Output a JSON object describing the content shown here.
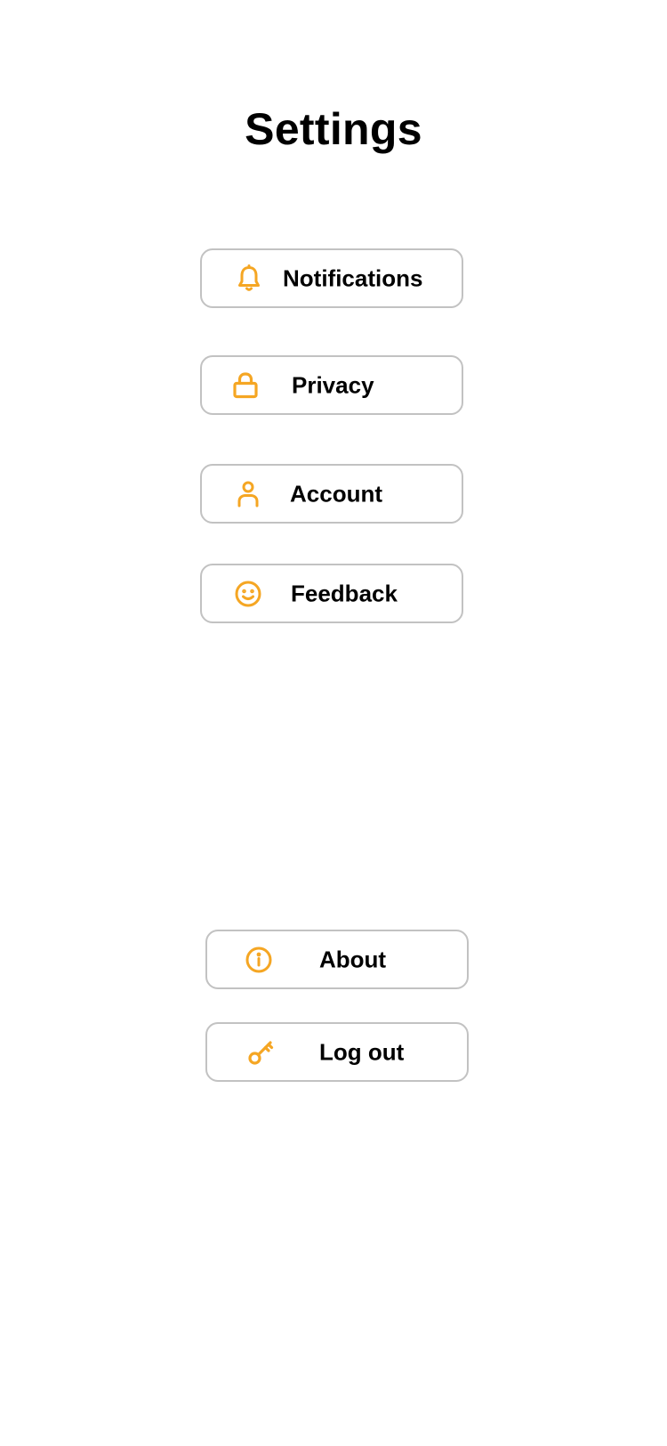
{
  "page": {
    "title": "Settings"
  },
  "theme": {
    "accent_color": "#F5A623",
    "border_color": "#C2C2C2",
    "text_color": "#000000",
    "background_color": "#FFFFFF"
  },
  "menu": {
    "items": [
      {
        "label": "Notifications",
        "icon": "bell-icon"
      },
      {
        "label": "Privacy",
        "icon": "lock-icon"
      },
      {
        "label": "Account",
        "icon": "user-icon"
      },
      {
        "label": "Feedback",
        "icon": "smiley-icon"
      }
    ]
  },
  "footer_menu": {
    "items": [
      {
        "label": "About",
        "icon": "info-icon"
      },
      {
        "label": "Log out",
        "icon": "key-icon"
      }
    ]
  }
}
